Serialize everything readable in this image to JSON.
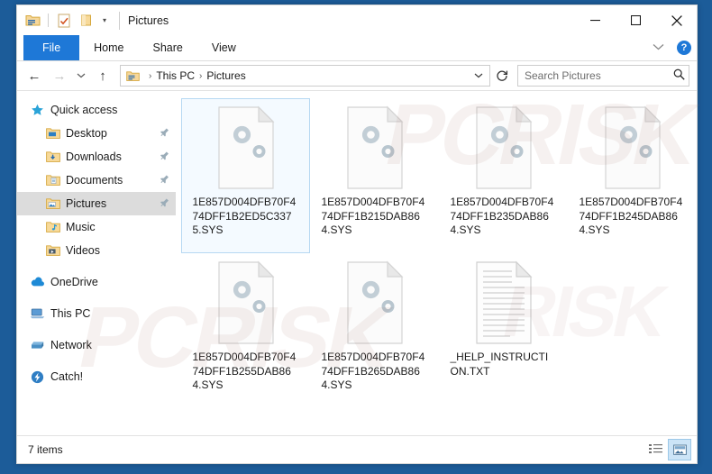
{
  "window": {
    "title": "Pictures",
    "quick_access_toolbar": [
      {
        "name": "folder-properties-icon",
        "label": "Folder"
      },
      {
        "name": "properties-check-icon",
        "label": "Properties"
      },
      {
        "name": "new-folder-icon",
        "label": "New folder"
      },
      {
        "name": "customize-caret-icon",
        "label": "▾"
      }
    ],
    "controls": {
      "minimize": "─",
      "maximize": "□",
      "close": "✕"
    }
  },
  "ribbon": {
    "tabs": [
      {
        "label": "File",
        "active": true
      },
      {
        "label": "Home",
        "active": false
      },
      {
        "label": "Share",
        "active": false
      },
      {
        "label": "View",
        "active": false
      }
    ],
    "expand_caret": "⌄",
    "help_label": "?"
  },
  "address_bar": {
    "back": "←",
    "forward": "→",
    "recent_caret": "⌄",
    "up": "↑",
    "path_crumbs": [
      "This PC",
      "Pictures"
    ],
    "path_separator": "›",
    "path_caret": "⌄",
    "refresh": "↻"
  },
  "search": {
    "placeholder": "Search Pictures",
    "value": "",
    "icon": "⌕"
  },
  "sidebar": {
    "items": [
      {
        "label": "Quick access",
        "icon": "star-icon",
        "indent": false,
        "pinned": false,
        "selected": false
      },
      {
        "label": "Desktop",
        "icon": "desktop-folder-icon",
        "indent": true,
        "pinned": true,
        "selected": false
      },
      {
        "label": "Downloads",
        "icon": "downloads-folder-icon",
        "indent": true,
        "pinned": true,
        "selected": false
      },
      {
        "label": "Documents",
        "icon": "documents-folder-icon",
        "indent": true,
        "pinned": true,
        "selected": false
      },
      {
        "label": "Pictures",
        "icon": "pictures-folder-icon",
        "indent": true,
        "pinned": true,
        "selected": true
      },
      {
        "label": "Music",
        "icon": "music-folder-icon",
        "indent": true,
        "pinned": false,
        "selected": false
      },
      {
        "label": "Videos",
        "icon": "videos-folder-icon",
        "indent": true,
        "pinned": false,
        "selected": false
      },
      {
        "label": "OneDrive",
        "icon": "onedrive-cloud-icon",
        "indent": false,
        "pinned": false,
        "selected": false,
        "gap_before": true
      },
      {
        "label": "This PC",
        "icon": "this-pc-icon",
        "indent": false,
        "pinned": false,
        "selected": false,
        "gap_before": true
      },
      {
        "label": "Network",
        "icon": "network-icon",
        "indent": false,
        "pinned": false,
        "selected": false,
        "gap_before": true
      },
      {
        "label": "Catch!",
        "icon": "catch-icon",
        "indent": false,
        "pinned": false,
        "selected": false,
        "gap_before": true
      }
    ]
  },
  "files": [
    {
      "name": "1E857D004DFB70F474DFF1B2ED5C3375.SYS",
      "type": "sys",
      "selected": true
    },
    {
      "name": "1E857D004DFB70F474DFF1B215DAB864.SYS",
      "type": "sys",
      "selected": false
    },
    {
      "name": "1E857D004DFB70F474DFF1B235DAB864.SYS",
      "type": "sys",
      "selected": false
    },
    {
      "name": "1E857D004DFB70F474DFF1B245DAB864.SYS",
      "type": "sys",
      "selected": false
    },
    {
      "name": "1E857D004DFB70F474DFF1B255DAB864.SYS",
      "type": "sys",
      "selected": false
    },
    {
      "name": "1E857D004DFB70F474DFF1B265DAB864.SYS",
      "type": "sys",
      "selected": false
    },
    {
      "name": "_HELP_INSTRUCTION.TXT",
      "type": "txt",
      "selected": false
    }
  ],
  "status_bar": {
    "item_count": "7 items",
    "views": [
      {
        "name": "details-view-button",
        "active": false
      },
      {
        "name": "large-icons-view-button",
        "active": true
      }
    ]
  },
  "watermark": {
    "text_1": "PCRISK",
    "text_2": "PCRISK",
    "text_3": "RISK"
  },
  "colors": {
    "desktop": "#1c5c99",
    "accent": "#1e78d7",
    "selection": "#cce4f7",
    "sidebar_selected": "#dcdcdc"
  }
}
